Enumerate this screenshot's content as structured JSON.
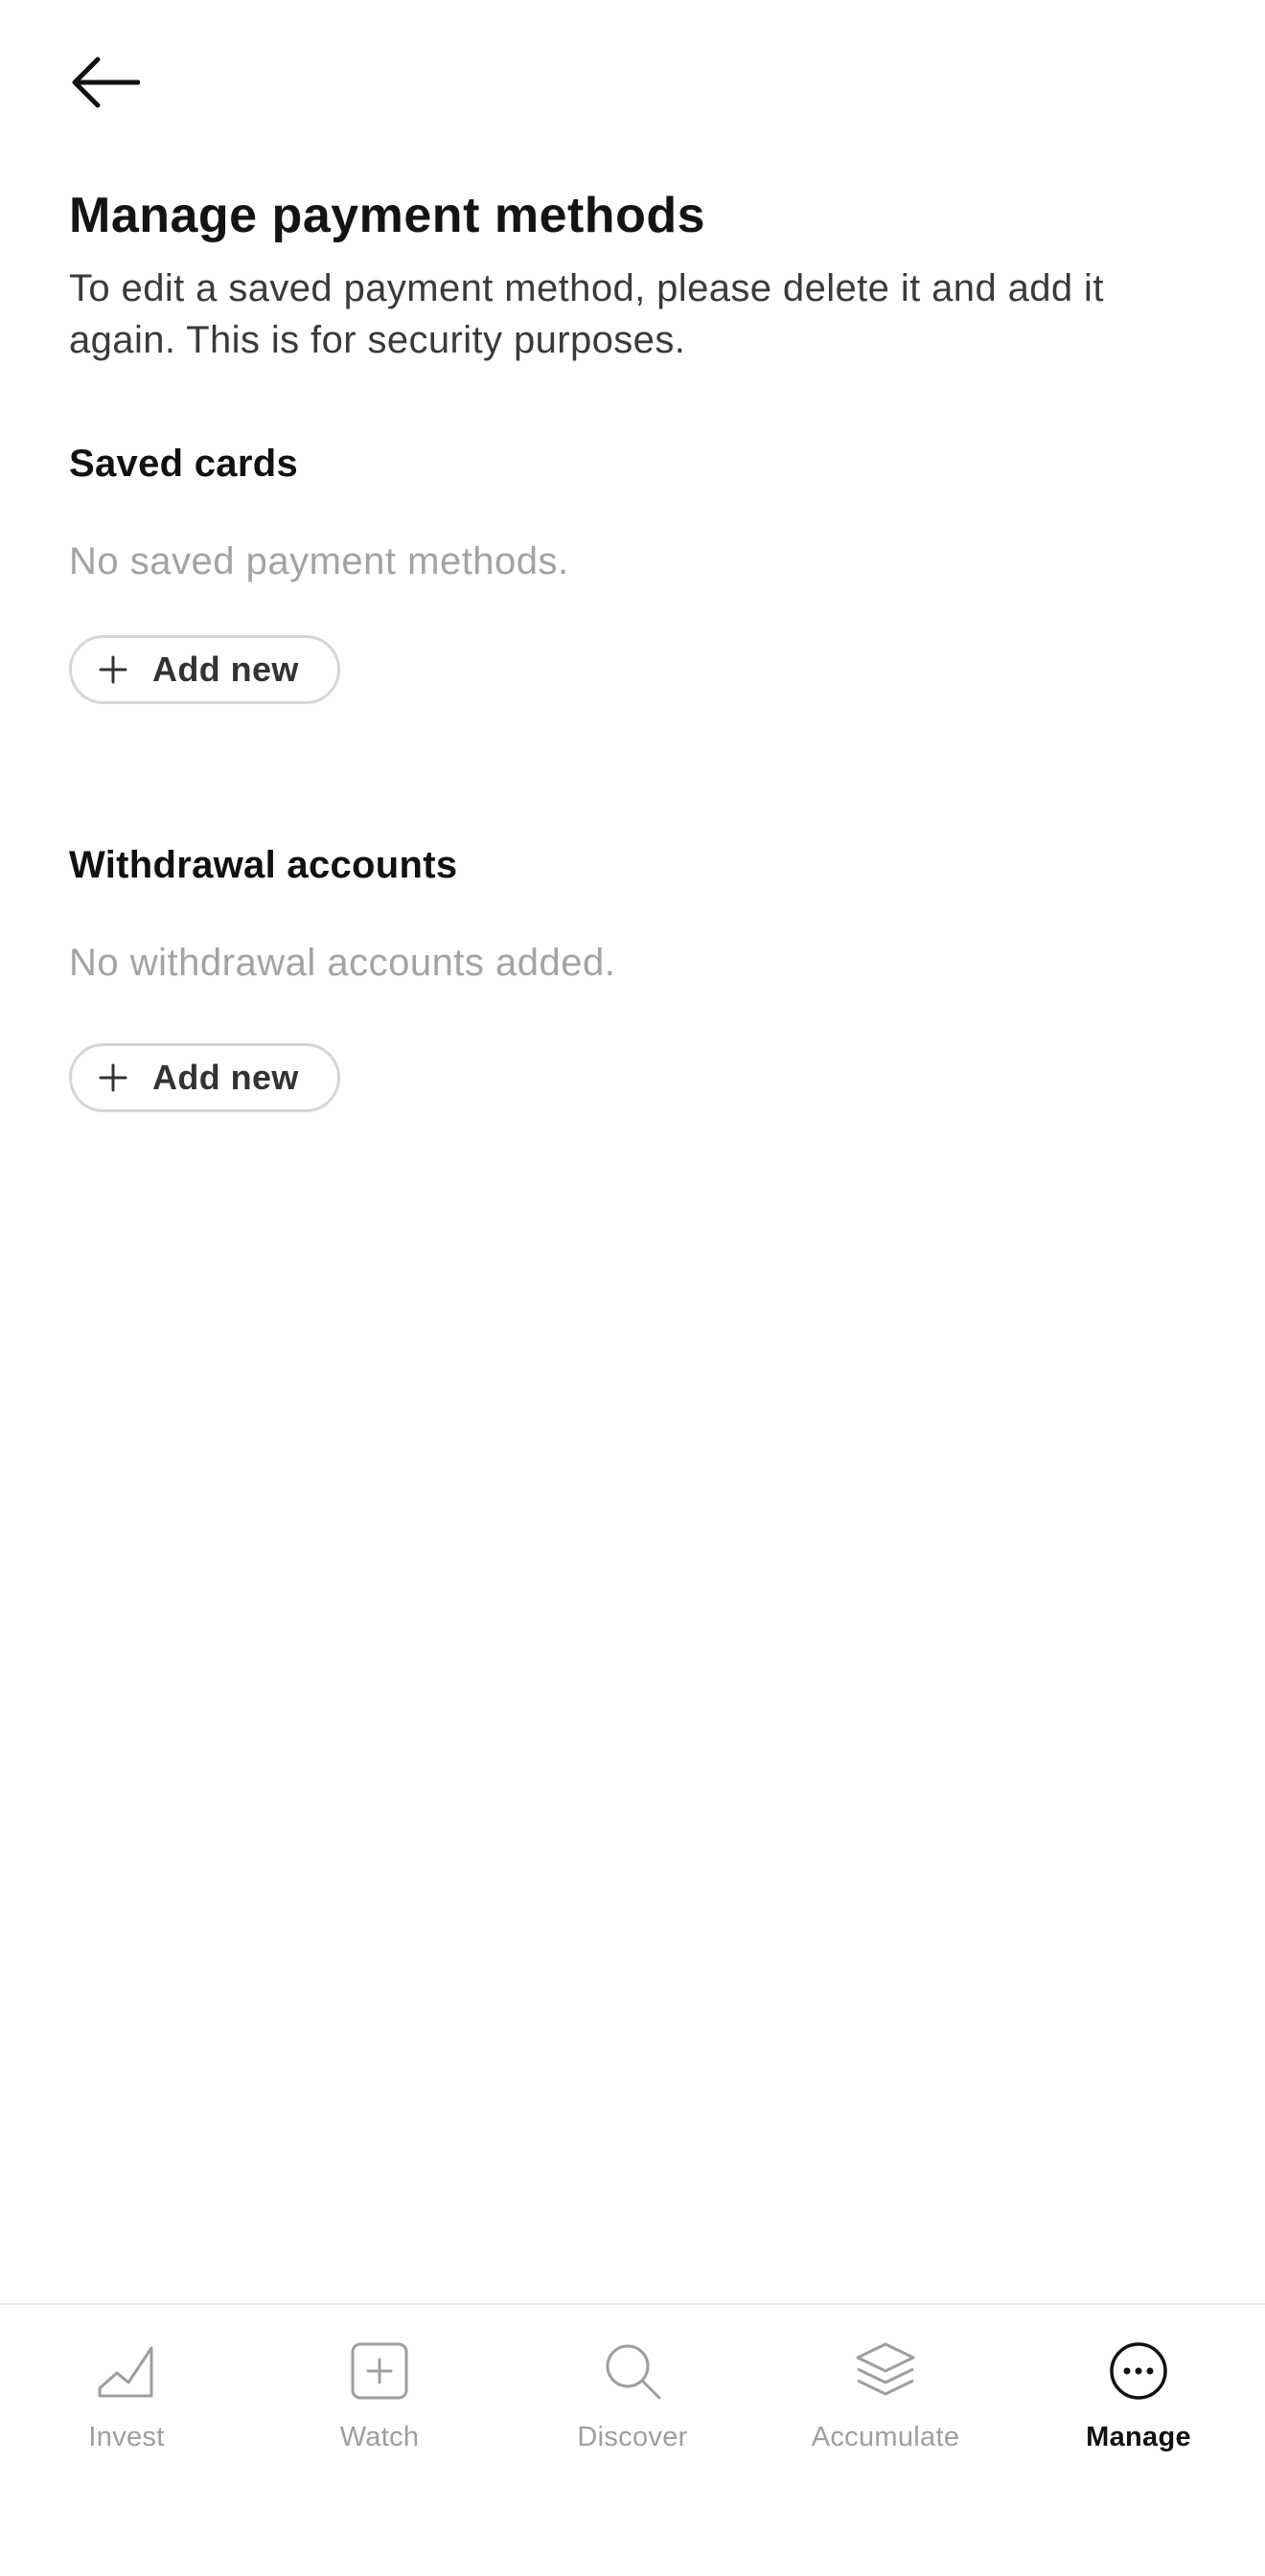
{
  "header": {
    "back_icon": "arrow-left-icon"
  },
  "page": {
    "title": "Manage payment methods",
    "subtitle": "To edit a saved payment method, please delete it and add it again. This is for security purposes."
  },
  "saved_cards": {
    "title": "Saved cards",
    "empty_text": "No saved payment methods.",
    "add_label": "Add new",
    "add_icon": "plus-icon"
  },
  "withdrawal_accounts": {
    "title": "Withdrawal accounts",
    "empty_text": "No withdrawal accounts added.",
    "add_label": "Add new",
    "add_icon": "plus-icon"
  },
  "nav": {
    "items": [
      {
        "label": "Invest",
        "icon": "chart-line-icon",
        "active": false
      },
      {
        "label": "Watch",
        "icon": "plus-square-icon",
        "active": false
      },
      {
        "label": "Discover",
        "icon": "search-icon",
        "active": false
      },
      {
        "label": "Accumulate",
        "icon": "layers-icon",
        "active": false
      },
      {
        "label": "Manage",
        "icon": "more-circle-icon",
        "active": true
      }
    ]
  },
  "colors": {
    "text_primary": "#111111",
    "text_muted": "#a3a3a3",
    "nav_inactive": "#9e9e9e",
    "border": "#d6d6d6"
  }
}
